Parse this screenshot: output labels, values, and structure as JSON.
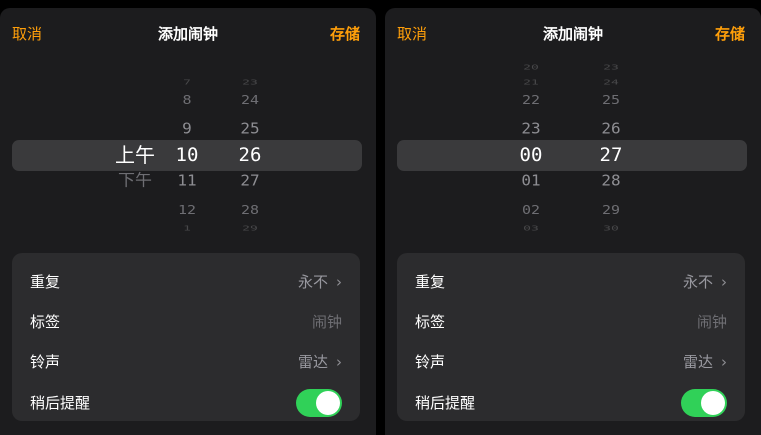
{
  "panels": [
    {
      "header": {
        "cancel": "取消",
        "title": "添加闹钟",
        "save": "存储"
      },
      "picker": {
        "ampm": [
          "上午",
          "下午"
        ],
        "hours": [
          "7",
          "8",
          "9",
          "10",
          "11",
          "12",
          "1"
        ],
        "minutes": [
          "23",
          "24",
          "25",
          "26",
          "27",
          "28",
          "29"
        ],
        "selected_index": 3
      },
      "settings": {
        "repeat_label": "重复",
        "repeat_value": "永不",
        "label_label": "标签",
        "label_placeholder": "闹钟",
        "sound_label": "铃声",
        "sound_value": "雷达",
        "snooze_label": "稍后提醒",
        "snooze_on": true
      }
    },
    {
      "header": {
        "cancel": "取消",
        "title": "添加闹钟",
        "save": "存储"
      },
      "picker": {
        "hours": [
          "20",
          "21",
          "22",
          "23",
          "00",
          "01",
          "02",
          "03"
        ],
        "minutes": [
          "23",
          "24",
          "25",
          "26",
          "27",
          "28",
          "29",
          "30"
        ],
        "selected_index": 4
      },
      "settings": {
        "repeat_label": "重复",
        "repeat_value": "永不",
        "label_label": "标签",
        "label_placeholder": "闹钟",
        "sound_label": "铃声",
        "sound_value": "雷达",
        "snooze_label": "稍后提醒",
        "snooze_on": true
      }
    }
  ],
  "colors": {
    "accent": "#ff9f0a",
    "toggle_on": "#30d158",
    "panel": "#1c1c1e",
    "card": "#2c2c2e"
  }
}
